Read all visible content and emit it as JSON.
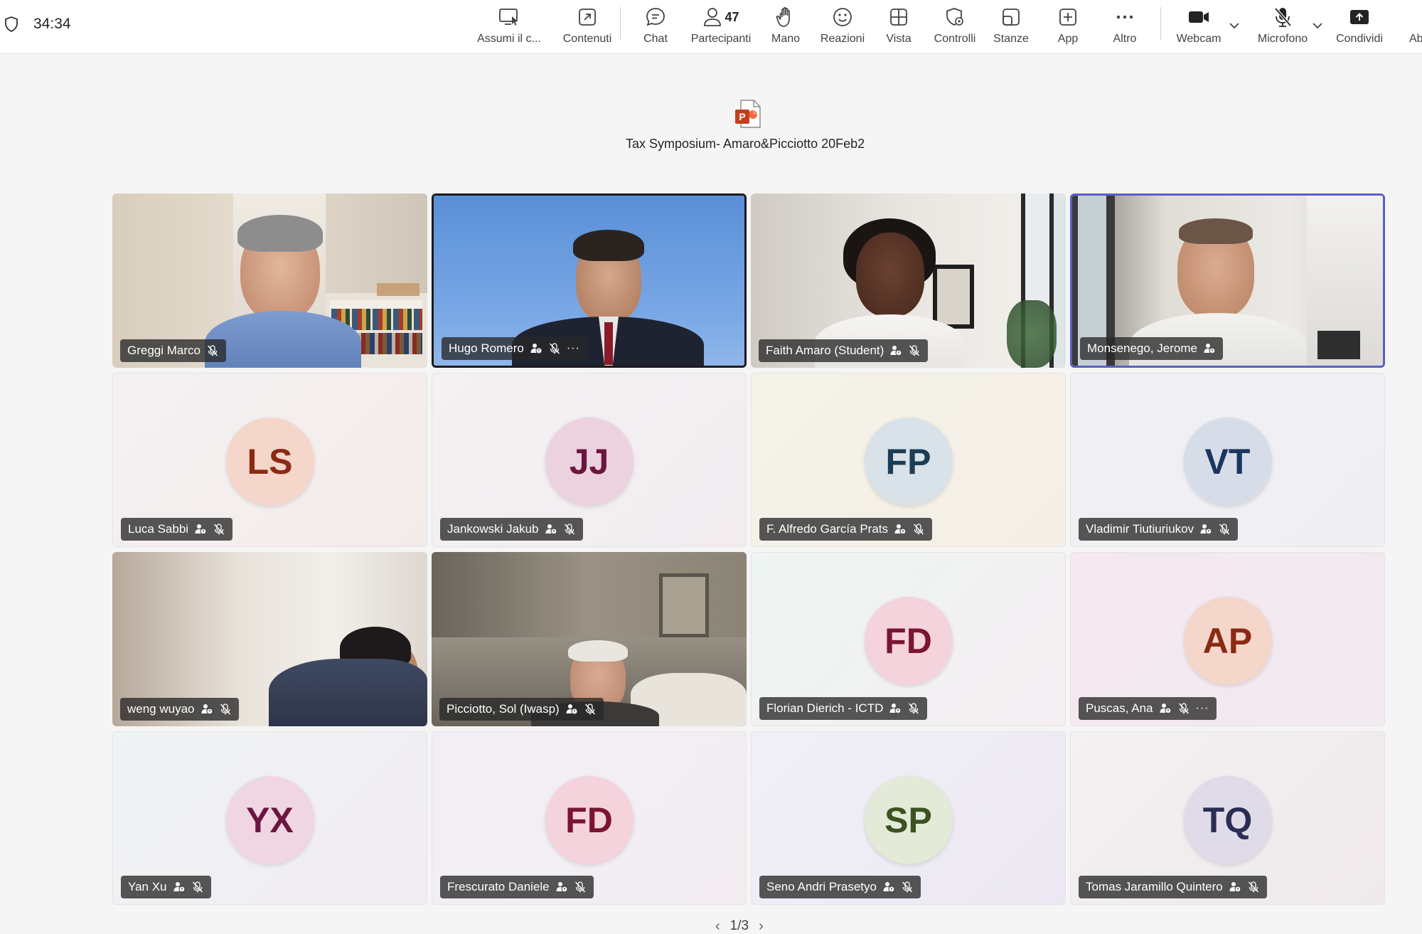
{
  "header": {
    "timer": "34:34"
  },
  "toolbar": {
    "items": [
      {
        "key": "take-control",
        "label": "Assumi il c...",
        "icon": "screen-pointer-icon"
      },
      {
        "key": "content",
        "label": "Contenuti",
        "icon": "popout-icon"
      },
      {
        "key": "chat",
        "label": "Chat",
        "icon": "chat-icon"
      },
      {
        "key": "participants",
        "label": "Partecipanti",
        "icon": "person-icon",
        "count": "47"
      },
      {
        "key": "hand",
        "label": "Mano",
        "icon": "hand-icon"
      },
      {
        "key": "reactions",
        "label": "Reazioni",
        "icon": "smile-icon"
      },
      {
        "key": "view",
        "label": "Vista",
        "icon": "grid-icon"
      },
      {
        "key": "controls",
        "label": "Controlli",
        "icon": "shield-gear-icon"
      },
      {
        "key": "rooms",
        "label": "Stanze",
        "icon": "rooms-icon"
      },
      {
        "key": "apps",
        "label": "App",
        "icon": "plus-square-icon"
      },
      {
        "key": "more",
        "label": "Altro",
        "icon": "more-icon"
      },
      {
        "key": "webcam",
        "label": "Webcam",
        "icon": "camera-icon"
      },
      {
        "key": "mic",
        "label": "Microfono",
        "icon": "mic-off-icon"
      },
      {
        "key": "share",
        "label": "Condividi",
        "icon": "share-icon"
      },
      {
        "key": "leave",
        "label": "Ab",
        "icon": ""
      }
    ]
  },
  "shared_content": {
    "title": "Tax Symposium- Amaro&Picciotto 20Feb2"
  },
  "participants": [
    {
      "name": "Greggi Marco",
      "type": "video"
    },
    {
      "name": "Hugo Romero",
      "type": "video",
      "state": "active"
    },
    {
      "name": "Faith Amaro (Student)",
      "type": "video"
    },
    {
      "name": "Monsenego, Jerome",
      "type": "video",
      "state": "speaking"
    },
    {
      "name": "Luca Sabbi",
      "initials": "LS",
      "bg": "#f5d6cb",
      "fg": "#8a2a12"
    },
    {
      "name": "Jankowski Jakub",
      "initials": "JJ",
      "bg": "#ecd2de",
      "fg": "#6b1540"
    },
    {
      "name": "F. Alfredo García Prats",
      "initials": "FP",
      "bg": "#d9e2e8",
      "fg": "#1c3d55"
    },
    {
      "name": "Vladimir Tiutiuriukov",
      "initials": "VT",
      "bg": "#d6dde9",
      "fg": "#1a3560"
    },
    {
      "name": "weng wuyao",
      "type": "video"
    },
    {
      "name": "Picciotto, Sol (Iwasp)",
      "type": "video"
    },
    {
      "name": "Florian Dierich - ICTD",
      "initials": "FD",
      "bg": "#f5d3dc",
      "fg": "#7a1530"
    },
    {
      "name": "Puscas, Ana",
      "initials": "AP",
      "bg": "#f5d6cb",
      "fg": "#8a2a12"
    },
    {
      "name": "Yan Xu",
      "initials": "YX",
      "bg": "#efd6e2",
      "fg": "#6b1540"
    },
    {
      "name": "Frescurato Daniele",
      "initials": "FD",
      "bg": "#f5d3dc",
      "fg": "#7a1530"
    },
    {
      "name": "Seno Andri Prasetyo",
      "initials": "SP",
      "bg": "#e3ead7",
      "fg": "#3c5220"
    },
    {
      "name": "Tomas Jaramillo Quintero",
      "initials": "TQ",
      "bg": "#dfdbe8",
      "fg": "#2b2d55"
    }
  ],
  "pager": {
    "label": "1/3"
  },
  "colors": {
    "accent": "#5b5fc7",
    "ppt": "#c43e1c"
  }
}
